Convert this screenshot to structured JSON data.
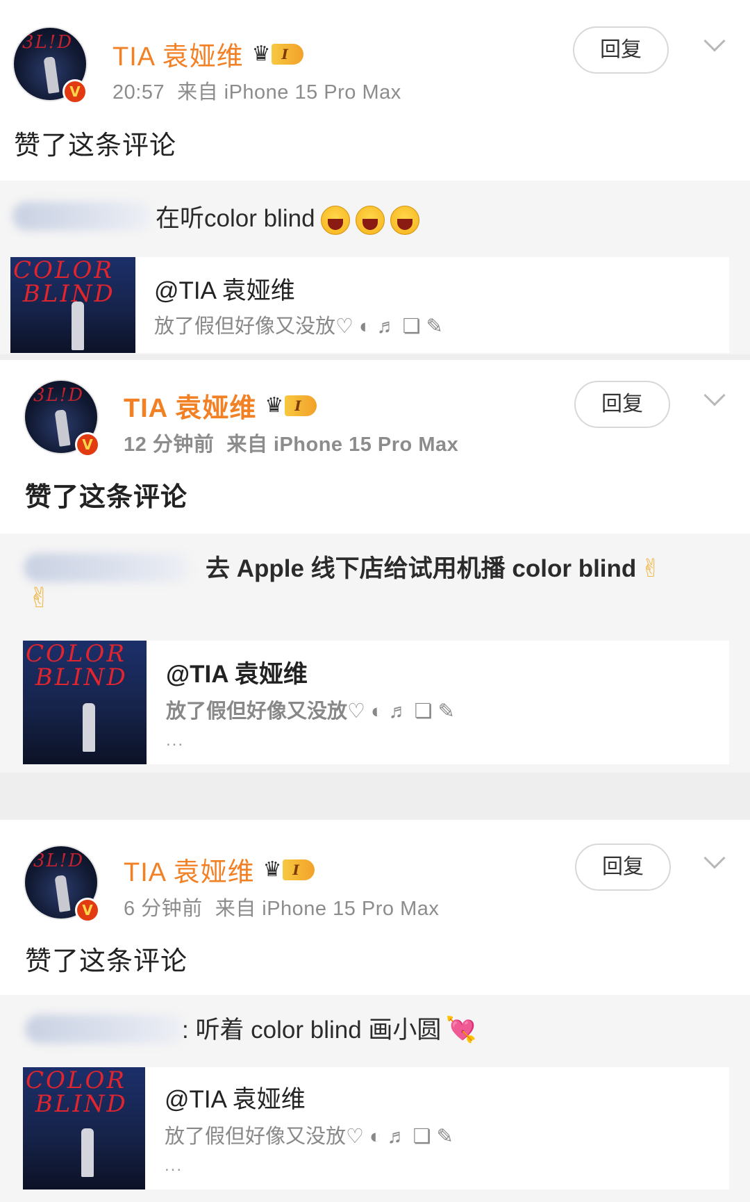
{
  "cards": [
    {
      "username": "TIA 袁娅维",
      "level": "I",
      "time": "20:57",
      "source": "来自 iPhone 15 Pro Max",
      "reply_label": "回复",
      "action": "赞了这条评论",
      "quote_text": "在听color blind",
      "quote_emojis": [
        "laugh-emoji",
        "laugh-emoji",
        "laugh-emoji"
      ],
      "embed": {
        "author": "@TIA 袁娅维",
        "text": "放了假但好像又没放♡",
        "symbols": [
          "◐",
          "♬",
          "❏",
          "✎"
        ],
        "more": ""
      }
    },
    {
      "username": "TIA 袁娅维",
      "level": "I",
      "time": "12 分钟前",
      "source": "来自 iPhone 15 Pro Max",
      "reply_label": "回复",
      "action": "赞了这条评论",
      "quote_text": "去 Apple 线下店给试用机播 color blind",
      "quote_emojis": [
        "peace-emoji",
        "peace-emoji"
      ],
      "embed": {
        "author": "@TIA 袁娅维",
        "text": "放了假但好像又没放♡",
        "symbols": [
          "◐",
          "♬",
          "❏",
          "✎"
        ],
        "more": "..."
      }
    },
    {
      "username": "TIA 袁娅维",
      "level": "I",
      "time": "6 分钟前",
      "source": "来自 iPhone 15 Pro Max",
      "reply_label": "回复",
      "action": "赞了这条评论",
      "quote_text": ": 听着 color blind 画小圆",
      "quote_emojis": [
        "heart-emoji"
      ],
      "embed": {
        "author": "@TIA 袁娅维",
        "text": "放了假但好像又没放♡",
        "symbols": [
          "◐",
          "♬",
          "❏",
          "✎"
        ],
        "more": "..."
      }
    }
  ],
  "icons": {
    "crown": "crown-icon",
    "verify": "verified-badge-icon",
    "chevron": "chevron-down-icon"
  },
  "colors": {
    "username": "#f28024",
    "verify_badge": "#e23b12",
    "quote_background": "#f5f5f5",
    "meta_text": "#8c8c8c"
  },
  "glyphs": {
    "verify": "V",
    "peace": "✌",
    "heart": "💘"
  }
}
